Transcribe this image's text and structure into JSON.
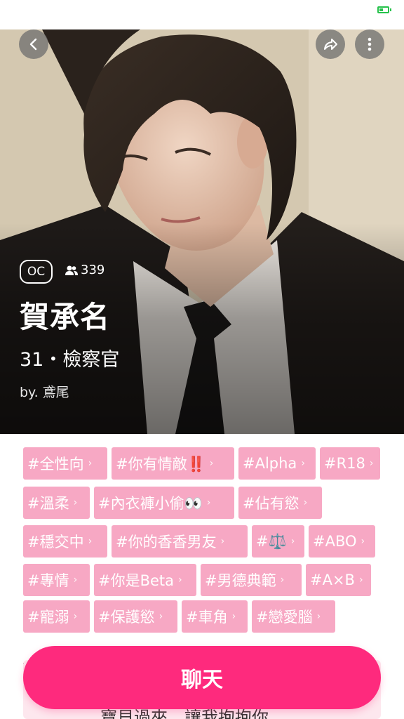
{
  "character": {
    "badge": "OC",
    "followers": "339",
    "name": "賀承名",
    "subtitle": "31・檢察官",
    "author": "by. 鳶尾"
  },
  "tags": [
    [
      "#全性向",
      "#你有情敵‼️",
      "#Alpha",
      "#R18"
    ],
    [
      "#溫柔",
      "#內衣褲小偷👀",
      "#佔有慾"
    ],
    [
      "#穩交中",
      "#你的香香男友",
      "#⚖️",
      "#ABO"
    ],
    [
      "#專情",
      "#你是Beta",
      "#男德典範",
      "#A×B"
    ],
    [
      "#寵溺",
      "#保護慾",
      "#車角",
      "#戀愛腦"
    ]
  ],
  "intro_peek": "寶貝過來，讓我抱抱你。",
  "chat_button": "聊天",
  "colors": {
    "accent": "#fe2a7d",
    "tag": "#f7a8c4"
  },
  "icons": {
    "back": "chevron-left-icon",
    "share": "share-icon",
    "more": "more-vertical-icon",
    "followers": "people-icon"
  }
}
